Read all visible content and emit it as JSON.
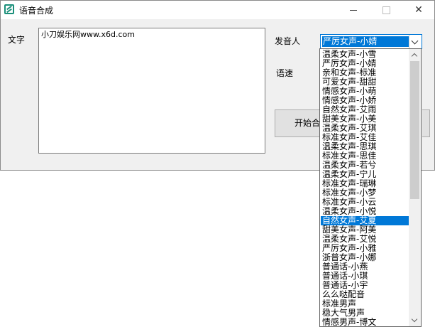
{
  "window": {
    "title": "语音合成",
    "icon": "app-logo-icon",
    "controls": [
      "minimize-icon",
      "maximize-icon",
      "close-icon"
    ]
  },
  "labels": {
    "text": "文字",
    "speaker": "发音人",
    "speed": "语速"
  },
  "text_input": {
    "value": "小刀娱乐网www.x6d.com"
  },
  "speaker_combo": {
    "selected": "严厉女声-小婧"
  },
  "start_button": {
    "label": "开始合成"
  },
  "dropdown": {
    "highlighted_index": 18,
    "options": [
      "温柔女声-小雪",
      "严厉女声-小婧",
      "亲和女声-标准",
      "可爱女声-甜甜",
      "情感女声-小萌",
      "情感女声-小娇",
      "自然女声-艾雨",
      "甜美女声-小美",
      "温柔女声-艾琪",
      "标准女声-艾佳",
      "温柔女声-思琪",
      "标准女声-思佳",
      "温柔女声-若兮",
      "温柔女声-宁儿",
      "标准女声-瑞琳",
      "标准女声-小梦",
      "标准女声-小云",
      "温柔女声-小悦",
      "自然女声-艾夏",
      "甜美女声-阿美",
      "温柔女声-艾悦",
      "严厉女声-小雅",
      "浙普女声-小娜",
      "普通话-小燕",
      "普通话-小琪",
      "普通话-小宇",
      "么么哒配音",
      "标准男声",
      "稳大气男声",
      "情感男声-博文"
    ]
  },
  "colors": {
    "accent": "#0078d7",
    "window_bg": "#f0f0f0"
  }
}
